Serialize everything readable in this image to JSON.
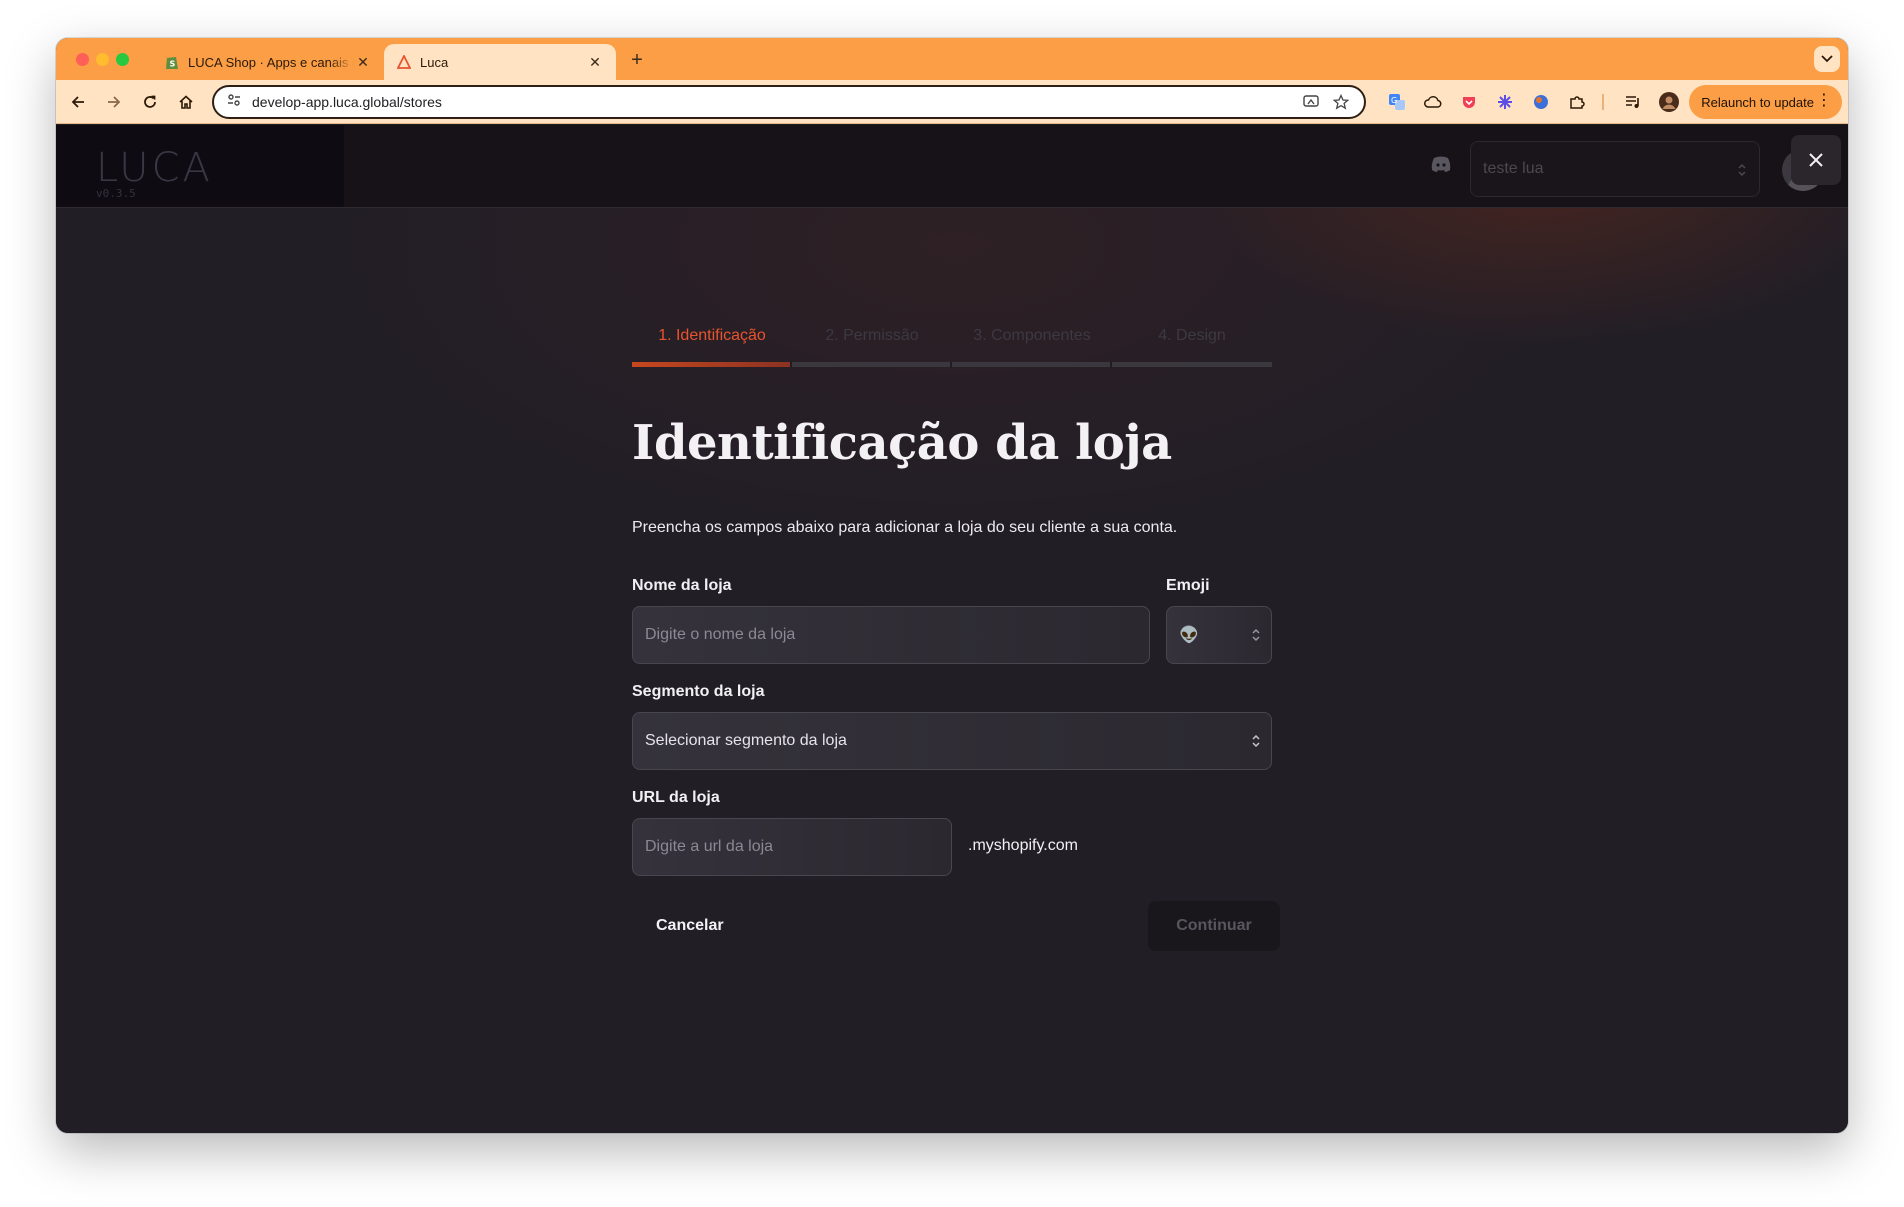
{
  "browser": {
    "tabs": [
      {
        "title": "LUCA Shop · Apps e canais de vendas",
        "active": false,
        "favicon": "shopify-icon"
      },
      {
        "title": "Luca",
        "active": true,
        "favicon": "luca-triangle-icon"
      }
    ],
    "url": "develop-app.luca.global/stores",
    "relaunch_label": "Relaunch to update",
    "accent_color": "#fb9e45"
  },
  "app": {
    "logo": "LUCA",
    "version": "v0.3.5",
    "store_selector": {
      "value": "teste lua"
    }
  },
  "wizard": {
    "steps": [
      {
        "label": "1. Identificação",
        "active": true
      },
      {
        "label": "2. Permissão",
        "active": false
      },
      {
        "label": "3. Componentes",
        "active": false
      },
      {
        "label": "4. Design",
        "active": false
      }
    ],
    "title": "Identificação da loja",
    "subtitle": "Preencha os campos abaixo para adicionar a loja do seu cliente a sua conta.",
    "fields": {
      "store_name": {
        "label": "Nome da loja",
        "placeholder": "Digite o nome da loja"
      },
      "emoji": {
        "label": "Emoji",
        "value": "👽"
      },
      "segment": {
        "label": "Segmento da loja",
        "placeholder": "Selecionar segmento da loja"
      },
      "url": {
        "label": "URL da loja",
        "placeholder": "Digite a url da loja",
        "suffix": ".myshopify.com"
      }
    },
    "cancel_label": "Cancelar",
    "continue_label": "Continuar",
    "accent_color": "#e8532f"
  }
}
